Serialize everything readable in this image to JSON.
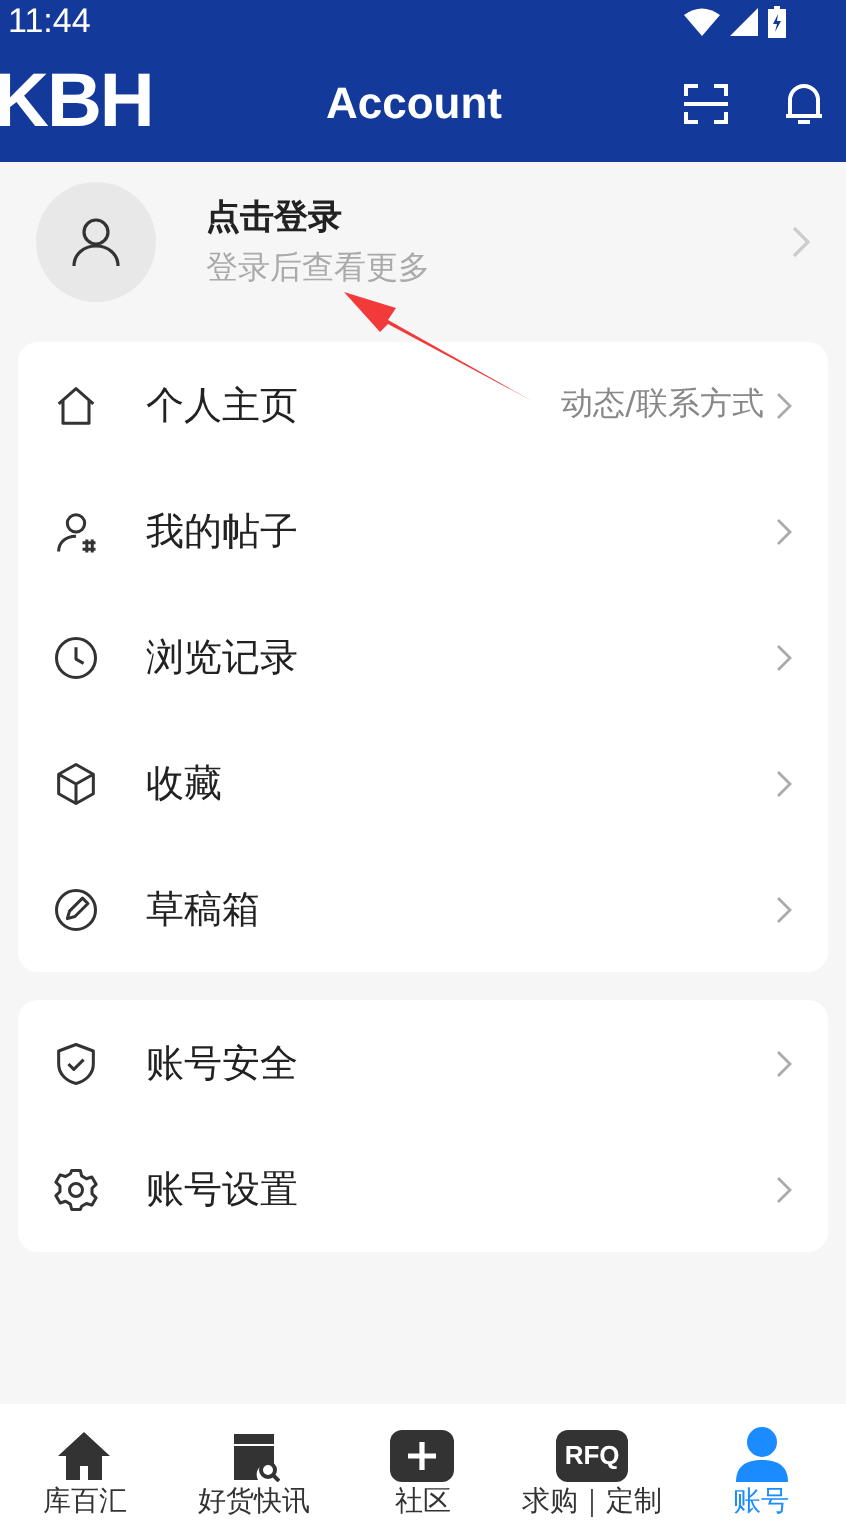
{
  "status_bar": {
    "time": "11:44"
  },
  "header": {
    "logo": "KBH",
    "title": "Account"
  },
  "profile": {
    "name": "点击登录",
    "hint": "登录后查看更多"
  },
  "menu_groups": [
    [
      {
        "label": "个人主页",
        "detail": "动态/联系方式"
      },
      {
        "label": "我的帖子"
      },
      {
        "label": "浏览记录"
      },
      {
        "label": "收藏"
      },
      {
        "label": "草稿箱"
      }
    ],
    [
      {
        "label": "账号安全"
      },
      {
        "label": "账号设置"
      }
    ]
  ],
  "bottom_nav": [
    {
      "label": "库百汇",
      "selected": false
    },
    {
      "label": "好货快讯",
      "selected": false
    },
    {
      "label": "社区",
      "selected": false
    },
    {
      "label": "求购｜定制",
      "selected": false,
      "badge": "RFQ"
    },
    {
      "label": "账号",
      "selected": true
    }
  ]
}
